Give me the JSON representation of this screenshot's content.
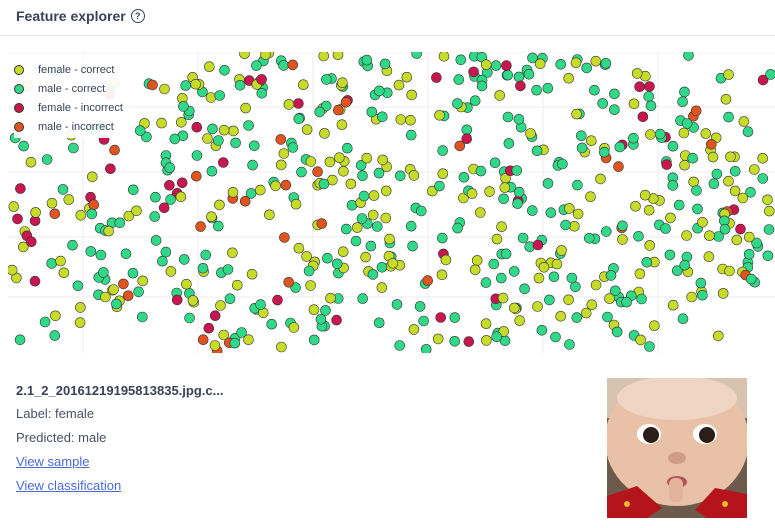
{
  "header": {
    "title": "Feature explorer",
    "help_icon": "question-circle-icon"
  },
  "chart_data": {
    "type": "scatter",
    "title": "",
    "xlabel": "",
    "ylabel": "",
    "grid": true,
    "legend_placement": "top-left",
    "series": [
      {
        "name": "female - correct",
        "color": "#c7dc28"
      },
      {
        "name": "male - correct",
        "color": "#2fd988"
      },
      {
        "name": "female - incorrect",
        "color": "#c8174f"
      },
      {
        "name": "male - incorrect",
        "color": "#e0541f"
      }
    ]
  },
  "selected": {
    "filename": "2.1_2_20161219195813835.jpg.c...",
    "label": "Label: female",
    "predicted": "Predicted: male",
    "view_sample": "View sample",
    "view_classification": "View classification"
  }
}
